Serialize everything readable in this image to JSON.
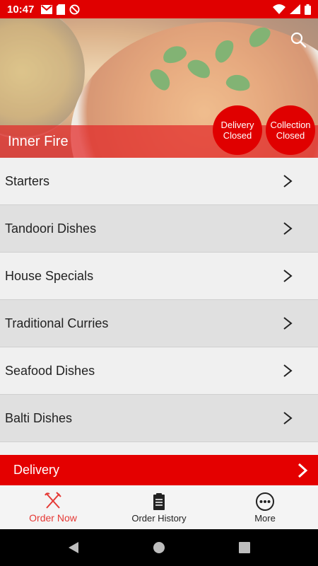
{
  "status_bar": {
    "time": "10:47",
    "left_icons": [
      "gmail-icon",
      "sd-card-icon",
      "do-not-disturb-icon"
    ],
    "right_icons": [
      "wifi-icon",
      "signal-icon",
      "battery-icon"
    ]
  },
  "header": {
    "restaurant_name": "Inner Fire",
    "delivery_status": {
      "line1": "Delivery",
      "line2": "Closed"
    },
    "collection_status": {
      "line1": "Collection",
      "line2": "Closed"
    }
  },
  "menu": {
    "categories": [
      {
        "label": "Starters"
      },
      {
        "label": "Tandoori Dishes"
      },
      {
        "label": "House Specials"
      },
      {
        "label": "Traditional Curries"
      },
      {
        "label": "Seafood Dishes"
      },
      {
        "label": "Balti Dishes"
      }
    ]
  },
  "delivery_bar": {
    "label": "Delivery"
  },
  "bottom_nav": {
    "items": [
      {
        "label": "Order Now",
        "icon": "fork-knife-icon",
        "active": true
      },
      {
        "label": "Order History",
        "icon": "clipboard-icon",
        "active": false
      },
      {
        "label": "More",
        "icon": "more-dots-icon",
        "active": false
      }
    ]
  },
  "colors": {
    "accent": "#e00000",
    "active_nav": "#e53935"
  }
}
